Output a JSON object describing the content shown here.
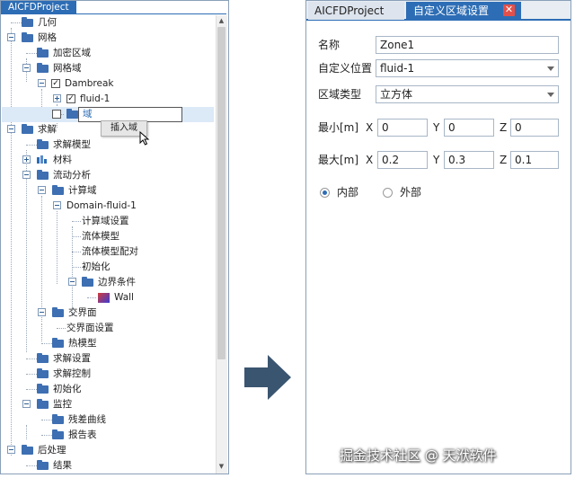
{
  "left": {
    "tab_title": "AICFDProject",
    "tree": [
      {
        "label": "几何"
      },
      {
        "label": "网格"
      },
      {
        "label": "加密区域"
      },
      {
        "label": "网格域"
      },
      {
        "label": "Dambreak"
      },
      {
        "label": "fluid-1"
      },
      {
        "label": "域"
      },
      {
        "label": "求解"
      },
      {
        "label": "求解模型"
      },
      {
        "label": "材料"
      },
      {
        "label": "流动分析"
      },
      {
        "label": "计算域"
      },
      {
        "label": "Domain-fluid-1"
      },
      {
        "label": "计算域设置"
      },
      {
        "label": "流体模型"
      },
      {
        "label": "流体模型配对"
      },
      {
        "label": "初始化"
      },
      {
        "label": "边界条件"
      },
      {
        "label": "Wall"
      },
      {
        "label": "交界面"
      },
      {
        "label": "交界面设置"
      },
      {
        "label": "热模型"
      },
      {
        "label": "求解设置"
      },
      {
        "label": "求解控制"
      },
      {
        "label": "初始化"
      },
      {
        "label": "监控"
      },
      {
        "label": "残差曲线"
      },
      {
        "label": "报告表"
      },
      {
        "label": "后处理"
      },
      {
        "label": "结果"
      }
    ],
    "context_menu_item": "插入域"
  },
  "right": {
    "tabs": [
      {
        "label": "AICFDProject"
      },
      {
        "label": "自定义区域设置"
      }
    ],
    "close_glyph": "✕",
    "name_label": "名称",
    "name_value": "Zone1",
    "position_label": "自定义位置",
    "position_value": "fluid-1",
    "zone_type_label": "区域类型",
    "zone_type_value": "立方体",
    "min_label": "最小[m]",
    "max_label": "最大[m]",
    "axis_x": "X",
    "axis_y": "Y",
    "axis_z": "Z",
    "min_values": {
      "x": "0",
      "y": "0",
      "z": "0"
    },
    "max_values": {
      "x": "0.2",
      "y": "0.3",
      "z": "0.1"
    },
    "radio_inside": "内部",
    "radio_outside": "外部",
    "radio_selected": "内部"
  },
  "watermark": "掘金技术社区 @ 天洑软件",
  "colors": {
    "accent": "#2d6db5",
    "close": "#e3504a",
    "folder": "#3d6fb2"
  }
}
